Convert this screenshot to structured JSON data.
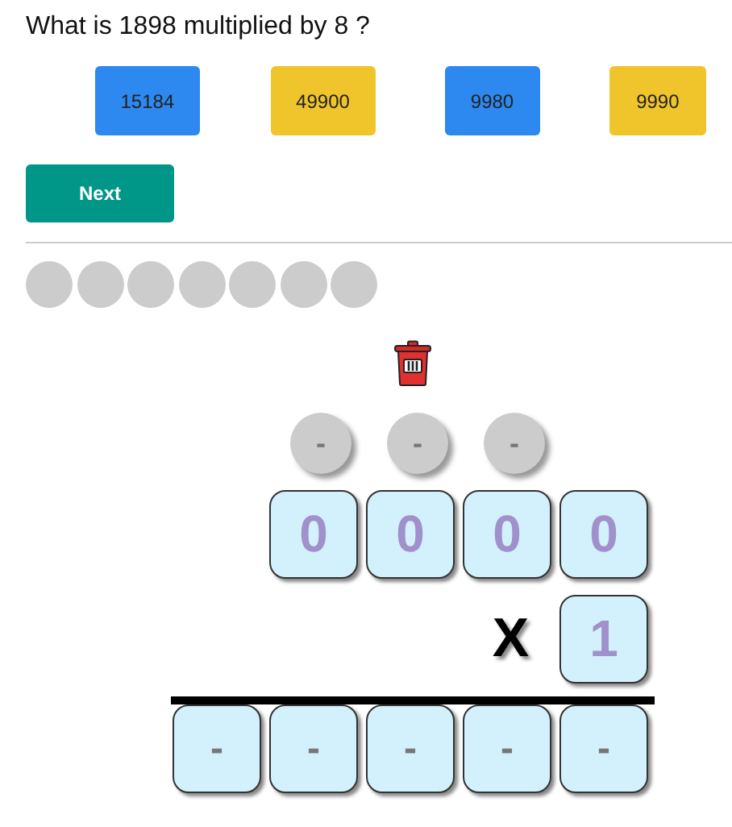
{
  "question": "What is 1898 multiplied by 8 ?",
  "options": [
    {
      "label": "15184",
      "color": "#2d88f0"
    },
    {
      "label": "49900",
      "color": "#f0c52c"
    },
    {
      "label": "9980",
      "color": "#2d88f0"
    },
    {
      "label": "9990",
      "color": "#f0c52c"
    }
  ],
  "next_button": "Next",
  "progress_dots": [
    {
      "color": "#cccccc"
    },
    {
      "color": "#cccccc"
    },
    {
      "color": "#cccccc"
    },
    {
      "color": "#cccccc"
    },
    {
      "color": "#cccccc"
    },
    {
      "color": "#cccccc"
    },
    {
      "color": "#cccccc"
    }
  ],
  "carries": [
    "-",
    "-",
    "-"
  ],
  "top_digits": [
    "0",
    "0",
    "0",
    "0"
  ],
  "operator": "X",
  "multiplier_digits": [
    "1"
  ],
  "result_digits": [
    "-",
    "-",
    "-",
    "-",
    "-"
  ]
}
